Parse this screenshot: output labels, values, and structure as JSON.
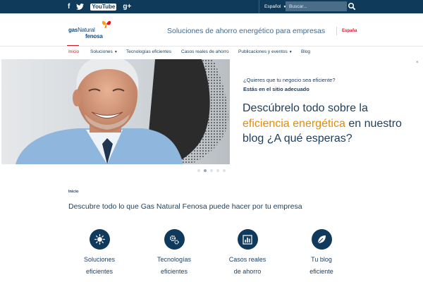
{
  "topbar": {
    "social": [
      {
        "name": "facebook",
        "glyph": "f"
      },
      {
        "name": "twitter",
        "glyph": "t"
      },
      {
        "name": "youtube",
        "glyph": "YouTube"
      },
      {
        "name": "googleplus",
        "glyph": "g+"
      }
    ],
    "language": "Español",
    "search_placeholder": "Buscar..."
  },
  "header": {
    "logo_line1_bold": "gas",
    "logo_line1_rest": "Natural",
    "logo_line2": "fenosa",
    "tagline": "Soluciones de ahorro energético para empresas",
    "country": "España"
  },
  "nav": {
    "items": [
      {
        "label": "Inicio",
        "active": true
      },
      {
        "label": "Soluciones",
        "dropdown": true
      },
      {
        "label": "Tecnologías eficientes"
      },
      {
        "label": "Casos reales de ahorro"
      },
      {
        "label": "Publicaciones y eventos",
        "dropdown": true
      },
      {
        "label": "Blog"
      }
    ]
  },
  "hero": {
    "question": "¿Quieres que tu negocio sea eficiente?",
    "answer": "Estás en el sitio adecuado",
    "headline_pre": "Descúbrelo todo sobre la ",
    "headline_highlight": "eficiencia energética",
    "headline_post": " en nuestro blog ¿A qué esperas?",
    "close_glyph": "×",
    "slides": 5,
    "active_slide": 1
  },
  "section": {
    "breadcrumb": "Inicio",
    "intro": "Descubre todo lo que Gas Natural Fenosa puede hacer por tu empresa",
    "features": [
      {
        "icon": "sun-icon",
        "line1": "Soluciones",
        "line2": "eficientes"
      },
      {
        "icon": "gears-icon",
        "line1": "Tecnologías",
        "line2": "eficientes"
      },
      {
        "icon": "bar-chart-icon",
        "line1": "Casos reales",
        "line2": "de ahorro"
      },
      {
        "icon": "leaf-icon",
        "line1": "Tu blog",
        "line2": "eficiente"
      }
    ]
  },
  "colors": {
    "topbar": "#0f3a5a",
    "brand_blue": "#0f4c81",
    "accent_red": "#d5172a",
    "highlight_orange": "#e58a06",
    "icon_circle": "#103a5c"
  }
}
